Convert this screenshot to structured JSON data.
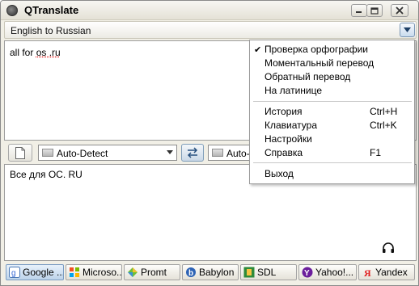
{
  "window": {
    "title": "QTranslate"
  },
  "direction": {
    "label": "English to Russian"
  },
  "source": {
    "text_prefix": "all for ",
    "text_underlined": "os .ru"
  },
  "toolbar": {
    "source_lang": "Auto-Detect",
    "target_lang": "Auto-D"
  },
  "result": {
    "text": "Все для ОС. RU"
  },
  "tabs": [
    {
      "label": "Google ...",
      "icon": "google-icon",
      "active": true
    },
    {
      "label": "Microso...",
      "icon": "microsoft-icon",
      "active": false
    },
    {
      "label": "Promt",
      "icon": "promt-icon",
      "active": false
    },
    {
      "label": "Babylon",
      "icon": "babylon-icon",
      "active": false
    },
    {
      "label": "SDL",
      "icon": "sdl-icon",
      "active": false
    },
    {
      "label": "Yahoo!...",
      "icon": "yahoo-icon",
      "active": false
    },
    {
      "label": "Yandex",
      "icon": "yandex-icon",
      "active": false
    }
  ],
  "menu": {
    "items": [
      {
        "label": "Проверка орфографии",
        "checked": true,
        "shortcut": ""
      },
      {
        "label": "Моментальный перевод",
        "checked": false,
        "shortcut": ""
      },
      {
        "label": "Обратный перевод",
        "checked": false,
        "shortcut": ""
      },
      {
        "label": "На латинице",
        "checked": false,
        "shortcut": ""
      },
      {
        "label": "История",
        "checked": false,
        "shortcut": "Ctrl+H"
      },
      {
        "label": "Клавиатура",
        "checked": false,
        "shortcut": "Ctrl+K"
      },
      {
        "label": "Настройки",
        "checked": false,
        "shortcut": ""
      },
      {
        "label": "Справка",
        "checked": false,
        "shortcut": "F1"
      },
      {
        "label": "Выход",
        "checked": false,
        "shortcut": ""
      }
    ],
    "check_glyph": "✔"
  },
  "colors": {
    "accent": "#7b9cc2",
    "spell_underline": "#dd0000"
  }
}
